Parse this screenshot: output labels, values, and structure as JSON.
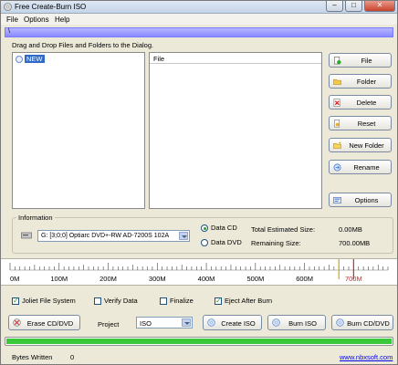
{
  "window": {
    "title": "Free Create-Burn ISO",
    "controls": {
      "minimize": "–",
      "maximize": "□",
      "close": "✕"
    }
  },
  "menu": {
    "items": [
      "File",
      "Options",
      "Help"
    ]
  },
  "hint_strip": {
    "text": "\\"
  },
  "instruction": "Drag and Drop Files and Folders to the Dialog.",
  "tree": {
    "root_label": "NEW"
  },
  "file_list": {
    "column_header": "File"
  },
  "side_buttons": [
    {
      "label": "File",
      "icon": "add-file-icon"
    },
    {
      "label": "Folder",
      "icon": "folder-icon"
    },
    {
      "label": "Delete",
      "icon": "delete-icon"
    },
    {
      "label": "Reset",
      "icon": "reset-icon"
    },
    {
      "label": "New Folder",
      "icon": "new-folder-icon"
    },
    {
      "label": "Rename",
      "icon": "rename-icon"
    },
    {
      "label": "Options",
      "icon": "options-icon"
    }
  ],
  "information": {
    "legend": "Information",
    "drive": "G: [3;0;0] Optiarc  DVD+-RW AD-7200S 102A",
    "media_options": [
      {
        "label": "Data CD",
        "selected": true
      },
      {
        "label": "Data DVD",
        "selected": false
      }
    ],
    "total_size_label": "Total Estimated Size:",
    "total_size_value": "0.00MB",
    "remaining_label": "Remaining Size:",
    "remaining_value": "700.00MB"
  },
  "ruler": {
    "labels": [
      "0M",
      "100M",
      "200M",
      "300M",
      "400M",
      "500M",
      "600M",
      "700M"
    ],
    "min_mb": 0,
    "max_mb": 770,
    "marker_mb": [
      670,
      700
    ],
    "marker_colors": [
      "#d6a400",
      "#cc2a2a"
    ]
  },
  "options": {
    "joliet": {
      "label": "Joliet File System",
      "checked": true
    },
    "verify": {
      "label": "Verify Data",
      "checked": false
    },
    "finalize": {
      "label": "Finalize",
      "checked": false
    },
    "eject": {
      "label": "Eject After Burn",
      "checked": true
    }
  },
  "actions": {
    "erase": "Erase CD/DVD",
    "project_label": "Project",
    "project_value": "ISO",
    "create_iso": "Create ISO",
    "burn_iso": "Burn ISO",
    "burn_disc": "Burn CD/DVD"
  },
  "progress": {
    "fraction": 1.0
  },
  "status": {
    "bytes_label": "Bytes Written",
    "bytes_value": "0",
    "link": "www.nbxsoft.com"
  },
  "colors": {
    "accent_strip": "#8a8aff",
    "selection": "#316ac5",
    "progress": "#3ac93a"
  }
}
